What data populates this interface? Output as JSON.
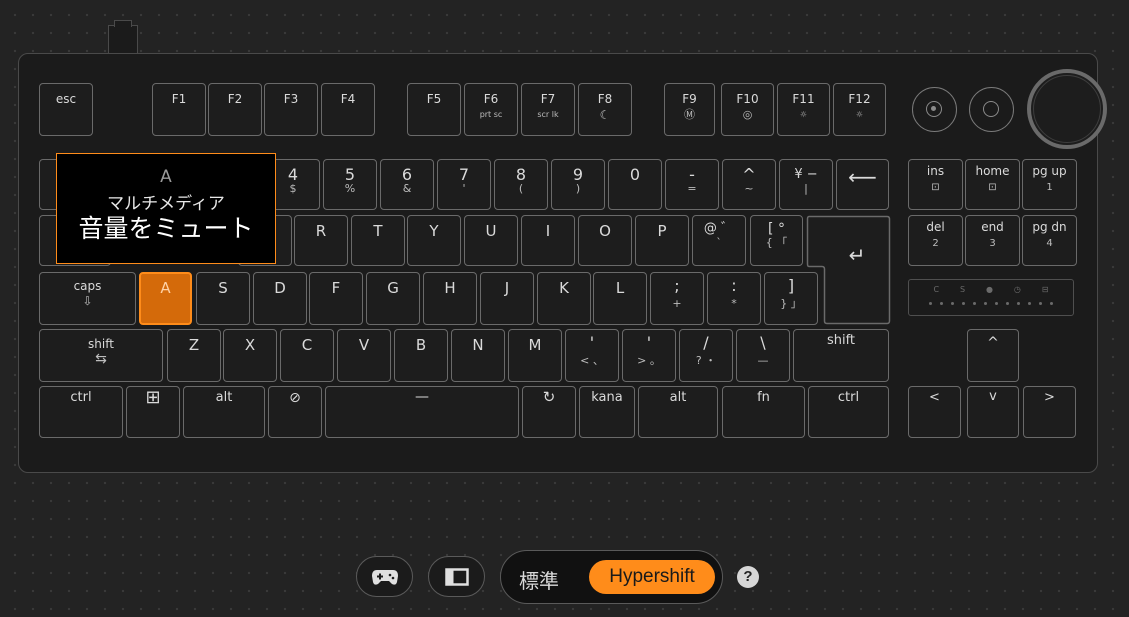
{
  "tooltip": {
    "key": "A",
    "category": "マルチメディア",
    "action": "音量をミュート"
  },
  "keys": {
    "esc": "esc",
    "f1": "F1",
    "f2": "F2",
    "f3": "F3",
    "f4": "F4",
    "f5": "F5",
    "f6": "F6",
    "f6_sub": "prt sc",
    "f7": "F7",
    "f7_sub": "scr lk",
    "f8": "F8",
    "f8_sub": "☾",
    "f9": "F9",
    "f9_sub": "Ⓜ",
    "f10": "F10",
    "f10_sub": "◎",
    "f11": "F11",
    "f11_sub": "☼",
    "f12": "F12",
    "f12_sub": "☼",
    "n4": "4",
    "n4_sub": "$",
    "n5": "5",
    "n5_sub": "%",
    "n6": "6",
    "n6_sub": "&",
    "n7": "7",
    "n7_sub": "'",
    "n8": "8",
    "n8_sub": "(",
    "n9": "9",
    "n9_sub": ")",
    "n0": "0",
    "minus": "-",
    "minus_sub": "=",
    "caret": "^",
    "caret_sub": "~",
    "yen": "¥ −",
    "yen_sub": "|",
    "backspace": "⟵",
    "r": "R",
    "t": "T",
    "y": "Y",
    "u": "U",
    "i": "I",
    "o": "O",
    "p": "P",
    "at": "@ ゛",
    "at_sub": "`",
    "bracket_l": "[ °",
    "bracket_l_sub": "{ 「",
    "enter": "↵",
    "caps": "caps",
    "caps_sub": "⇩",
    "a": "A",
    "s": "S",
    "d": "D",
    "f": "F",
    "g": "G",
    "h": "H",
    "j": "J",
    "k": "K",
    "l": "L",
    "semicolon": ";",
    "semicolon_sub": "+",
    "colon": ":",
    "colon_sub": "*",
    "bracket_r": "]",
    "bracket_r_sub": "} 」",
    "shift_l": "shift",
    "shift_l_sub": "⇆",
    "z": "Z",
    "x": "X",
    "c": "C",
    "v": "V",
    "b": "B",
    "n": "N",
    "m": "M",
    "comma": "'",
    "comma_sub": "< 、",
    "period": "'",
    "period_sub": "> 。",
    "slash": "/",
    "slash_sub": "? ・",
    "backslash": "\\",
    "backslash_sub": "—",
    "shift_r": "shift",
    "ctrl_l": "ctrl",
    "win": "⊞",
    "alt_l": "alt",
    "gamemode": "⊘",
    "space": "—",
    "convert": "↻",
    "kana": "kana",
    "alt_r": "alt",
    "fn": "fn",
    "ctrl_r": "ctrl",
    "ins": "ins",
    "ins_sub": "⊡",
    "home": "home",
    "home_sub": "⊡",
    "pgup": "pg up",
    "pgup_sub": "1",
    "del": "del",
    "del_sub": "2",
    "end": "end",
    "end_sub": "3",
    "pgdn": "pg dn",
    "pgdn_sub": "4",
    "up": "^",
    "left": "<",
    "down": "v",
    "right": ">"
  },
  "leds": {
    "icons": [
      "C",
      "S",
      "●",
      "◷",
      "⊟"
    ],
    "dot_count": 12
  },
  "modes": {
    "standard": "標準",
    "hypershift": "Hypershift"
  },
  "help": "?",
  "colors": {
    "accent": "#ff8c1a",
    "background": "#232323"
  }
}
